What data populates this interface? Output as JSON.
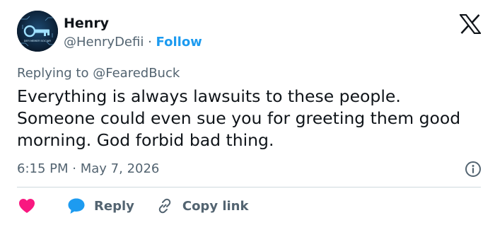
{
  "tweet": {
    "author": {
      "name": "Henry",
      "handle": "@HenryDefii",
      "avatar_text": "DEFI MEMEFI SOCIAFI"
    },
    "separator": "·",
    "follow_label": "Follow",
    "replying_prefix": "Replying to",
    "replying_to": "@FearedBuck",
    "text": "Everything is always lawsuits to these people. Someone could even sue you for greeting them good morning. God forbid bad thing.",
    "time": "6:15 PM",
    "date": "May 7, 2026"
  },
  "actions": {
    "like_icon": "heart-icon",
    "reply_label": "Reply",
    "copy_link_label": "Copy link"
  },
  "colors": {
    "accent": "#1d9bf0",
    "like": "#f91880",
    "muted": "#536471",
    "text": "#0f1419",
    "divider": "#cfd9de"
  }
}
